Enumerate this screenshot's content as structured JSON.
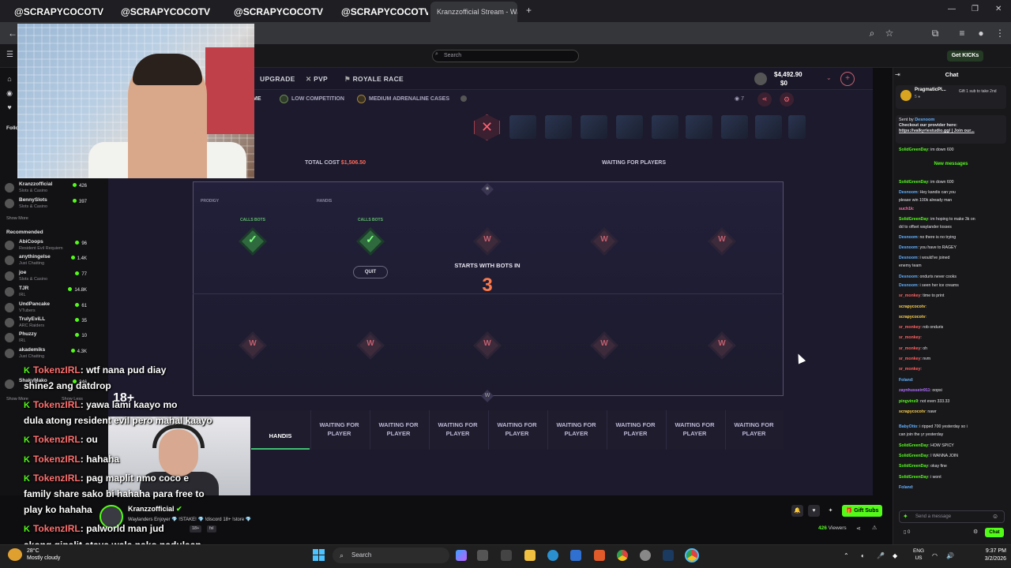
{
  "browser": {
    "tabs": [
      {
        "label": "@SCRAPYCOCOTV"
      },
      {
        "label": "@SCRAPYCOCOTV"
      },
      {
        "label": "@SCRAPYCOCOTV"
      },
      {
        "label": "@SCRAPYCOCOTV"
      },
      {
        "label": "Kranzzofficial Stream - Watc"
      }
    ]
  },
  "kick_header": {
    "search_placeholder": "Search",
    "get_kicks": "Get KICKs"
  },
  "sidebar": {
    "following_label": "Follo",
    "followed": [
      {
        "name": "Kranzzofficial",
        "category": "Slots & Casino",
        "viewers": "426"
      },
      {
        "name": "BennySlots",
        "category": "Slots & Casino",
        "viewers": "397"
      }
    ],
    "show_more": "Show More",
    "recommended_label": "Recommended",
    "recommended": [
      {
        "name": "AbiCoops",
        "category": "Resident Evil Requiem",
        "viewers": "96"
      },
      {
        "name": "anythingelse",
        "category": "Just Chatting",
        "viewers": "1.4K"
      },
      {
        "name": "joe",
        "category": "Slots & Casino",
        "viewers": "77"
      },
      {
        "name": "TJR",
        "category": "IRL",
        "viewers": "14.8K"
      },
      {
        "name": "UndPancake",
        "category": "VTubers",
        "viewers": "61"
      },
      {
        "name": "TrulyEviLL",
        "category": "ARC Raiders",
        "viewers": "35"
      },
      {
        "name": "Phuzzy",
        "category": "IRL",
        "viewers": "10"
      },
      {
        "name": "akademiks",
        "category": "Just Chatting",
        "viewers": "4.3K"
      },
      {
        "name": "ShakyMako",
        "category": "",
        "viewers": "346"
      }
    ],
    "show_more2": "Show More",
    "show_less": "Show Less"
  },
  "game": {
    "nav": {
      "upgrade": "UPGRADE",
      "pvp": "PVP",
      "royale_race": "ROYALE RACE"
    },
    "balance": "$4,492.90",
    "balance2": "$0",
    "tags": {
      "low": "LOW COMPETITION",
      "medium": "MEDIUM ADRENALINE CASES",
      "me": "ME",
      "eye_count": "7"
    },
    "close_symbol": "✕",
    "total_cost_label": "TOTAL COST",
    "total_cost_value": "$1,506.50",
    "waiting_label": "WAITING FOR PLAYERS",
    "player1": "PRODIGY",
    "player2": "HANDIS",
    "calls_bots": "CALLS BOTS",
    "quit": "QUIT",
    "starts_label": "STARTS WITH BOTS IN",
    "countdown": "3",
    "host_slot": "HANDIS",
    "waiting_slot": "WAITING FOR PLAYER"
  },
  "overlay_chat": [
    {
      "user": "TokenzIRL",
      "text": ": wtf nana pud diay"
    },
    {
      "user": "",
      "text": "shine2 ang datdrop"
    },
    {
      "user": "TokenzIRL",
      "text": ": yawa lami kaayo mo"
    },
    {
      "user": "",
      "text": "dula atong resident evil pero mahal kaayo"
    },
    {
      "user": "TokenzIRL",
      "text": ": ou"
    },
    {
      "user": "TokenzIRL",
      "text": ": hahaha"
    },
    {
      "user": "TokenzIRL",
      "text": ": pag maplit nmo coco e"
    },
    {
      "user": "",
      "text": "family share sako bi hahaha para free to"
    },
    {
      "user": "",
      "text": "play ko hahaha"
    },
    {
      "user": "TokenzIRL",
      "text": ": palworld man jud"
    },
    {
      "user": "",
      "text": "akong gipalit ataya wala nako nadulaan"
    }
  ],
  "age_badge": "18+",
  "stream": {
    "streamer": "Kranzzofficial",
    "tagline": "Waylanders Enjoyer 💎 !STAKE! 💎 !discord 18+ !store 💎",
    "badges": [
      "18+",
      "fsl"
    ],
    "viewers": "426",
    "viewers_label": "Viewers",
    "gift_subs": "Gift Subs"
  },
  "chat": {
    "title": "Chat",
    "pinned_name": "PragmaticPl...",
    "pinned_sub": "5 ●",
    "pinned_gift": "Gift 1 sub to take 2nd",
    "promo_sent": "Sent by",
    "promo_user": "Desnoom",
    "promo_text": "Checkout our provider here:",
    "promo_link": "https://valkyriestudio.gg/ | Join our...",
    "new_messages": "New messages",
    "messages": [
      {
        "reply": "Replying to BabyOtto: phone rip better",
        "user": "SolidGreenDay",
        "color": "#53fc18",
        "text": ": im down 600"
      },
      {
        "reply": "Replying to BabyOtto: phone rip better",
        "user": "SolidGreenDay",
        "color": "#53fc18",
        "text": ": im down 600"
      },
      {
        "reply": "",
        "user": "Desnoom",
        "color": "#5fb0ff",
        "text": ": Hey kandis can you"
      },
      {
        "reply": "",
        "user": "",
        "color": "#e6e6ea",
        "text": "please win 100k already man"
      },
      {
        "reply": "",
        "user": "such1k",
        "color": "#ff70b0",
        "text": ":"
      },
      {
        "reply": "",
        "user": "SolidGreenDay",
        "color": "#53fc18",
        "text": ": im hoping to make 3k on"
      },
      {
        "reply": "",
        "user": "",
        "color": "#e6e6ea",
        "text": "dd to offset waylander losses"
      },
      {
        "reply": "",
        "user": "Desnoom",
        "color": "#5fb0ff",
        "text": ": no there is no trying"
      },
      {
        "reply": "",
        "user": "Desnoom",
        "color": "#5fb0ff",
        "text": ": you have to RAGEY"
      },
      {
        "reply": "",
        "user": "Desnoom",
        "color": "#5fb0ff",
        "text": ": i would've joined"
      },
      {
        "reply": "",
        "user": "",
        "color": "#e6e6ea",
        "text": "enemy team"
      },
      {
        "reply": "",
        "user": "Desnoom",
        "color": "#5fb0ff",
        "text": ": onduris never cooks"
      },
      {
        "reply": "",
        "user": "Desnoom",
        "color": "#5fb0ff",
        "text": ": i seen her ice creams"
      },
      {
        "reply": "",
        "user": "sr_monkey",
        "color": "#ff6060",
        "text": ": time to print"
      },
      {
        "reply": "",
        "user": "scrapycocotv",
        "color": "#ffd24a",
        "text": ":"
      },
      {
        "reply": "",
        "user": "scrapycocotv",
        "color": "#ffd24a",
        "text": ":"
      },
      {
        "reply": "",
        "user": "sr_monkey",
        "color": "#ff6060",
        "text": ": rob onduris"
      },
      {
        "reply": "",
        "user": "sr_monkey",
        "color": "#ff6060",
        "text": ":"
      },
      {
        "reply": "",
        "user": "sr_monkey",
        "color": "#ff6060",
        "text": ": oh"
      },
      {
        "reply": "",
        "user": "sr_monkey",
        "color": "#ff6060",
        "text": ": nvm"
      },
      {
        "reply": "",
        "user": "sr_monkey",
        "color": "#ff6060",
        "text": ":"
      },
      {
        "reply": "",
        "user": "Foland",
        "color": "#5fb0ff",
        "text": ":"
      },
      {
        "reply": "",
        "user": "zaynhussein911",
        "color": "#b070ff",
        "text": ": oopsi"
      },
      {
        "reply": "",
        "user": "pingvins9",
        "color": "#53fc18",
        "text": ": not even 333.33"
      },
      {
        "reply": "",
        "user": "scrapycocotv",
        "color": "#ffd24a",
        "text": ": nawr"
      },
      {
        "reply": "Replying to SolidGreenDay: im down 600",
        "user": "BabyOtto",
        "color": "#5fb0ff",
        "text": ": i ripped 700 yesterday so i"
      },
      {
        "reply": "",
        "user": "",
        "color": "#e6e6ea",
        "text": "can join the yr yesterday"
      },
      {
        "reply": "",
        "user": "SolidGreenDay",
        "color": "#53fc18",
        "text": ": HOW SPICY"
      },
      {
        "reply": "",
        "user": "SolidGreenDay",
        "color": "#53fc18",
        "text": ": I WANNA JOIN"
      },
      {
        "reply": "",
        "user": "SolidGreenDay",
        "color": "#53fc18",
        "text": ": okay fine"
      },
      {
        "reply": "",
        "user": "SolidGreenDay",
        "color": "#53fc18",
        "text": ": i wont"
      },
      {
        "reply": "",
        "user": "Foland",
        "color": "#5fb0ff",
        "text": ":"
      }
    ],
    "send_placeholder": "Send a message",
    "chat_button": "Chat",
    "count": "0"
  },
  "taskbar": {
    "temp": "28°C",
    "weather": "Mostly cloudy",
    "search": "Search",
    "lang1": "ENG",
    "lang2": "US",
    "time": "9:37 PM",
    "date": "3/2/2026"
  }
}
